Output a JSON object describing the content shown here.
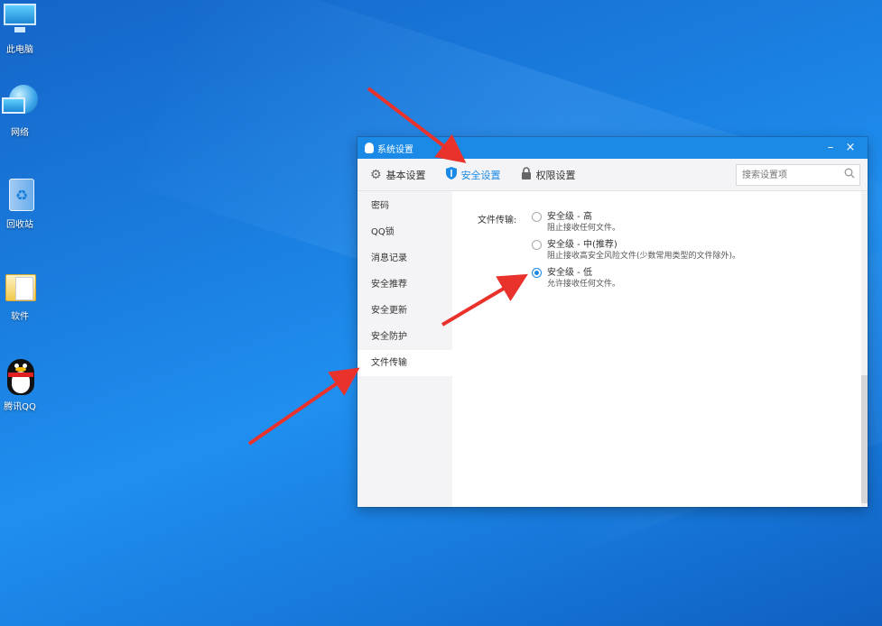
{
  "desktop": {
    "icons": [
      {
        "label": "此电脑",
        "icon": "computer-icon"
      },
      {
        "label": "网络",
        "icon": "network-icon"
      },
      {
        "label": "回收站",
        "icon": "recycle-bin-icon"
      },
      {
        "label": "软件",
        "icon": "folder-icon"
      },
      {
        "label": "腾讯QQ",
        "icon": "qq-penguin-icon"
      }
    ]
  },
  "window": {
    "title": "系统设置",
    "minimize": "–",
    "close": "×",
    "tabs": [
      {
        "label": "基本设置",
        "icon": "gear-icon",
        "active": false
      },
      {
        "label": "安全设置",
        "icon": "shield-icon",
        "active": true
      },
      {
        "label": "权限设置",
        "icon": "lock-icon",
        "active": false
      }
    ],
    "search_placeholder": "搜索设置项",
    "sidebar": [
      {
        "label": "密码",
        "active": false
      },
      {
        "label": "QQ锁",
        "active": false
      },
      {
        "label": "消息记录",
        "active": false
      },
      {
        "label": "安全推荐",
        "active": false
      },
      {
        "label": "安全更新",
        "active": false
      },
      {
        "label": "安全防护",
        "active": false
      },
      {
        "label": "文件传输",
        "active": true
      }
    ],
    "file_transfer": {
      "label": "文件传输:",
      "options": [
        {
          "title": "安全级 - 高",
          "desc": "阻止接收任何文件。",
          "selected": false
        },
        {
          "title": "安全级 - 中(推荐)",
          "desc": "阻止接收高安全风险文件(少数常用类型的文件除外)。",
          "selected": false
        },
        {
          "title": "安全级 - 低",
          "desc": "允许接收任何文件。",
          "selected": true
        }
      ]
    }
  },
  "colors": {
    "accent": "#1a8ae6",
    "arrow": "#e8322b",
    "desktop": "#1a7fe0"
  }
}
